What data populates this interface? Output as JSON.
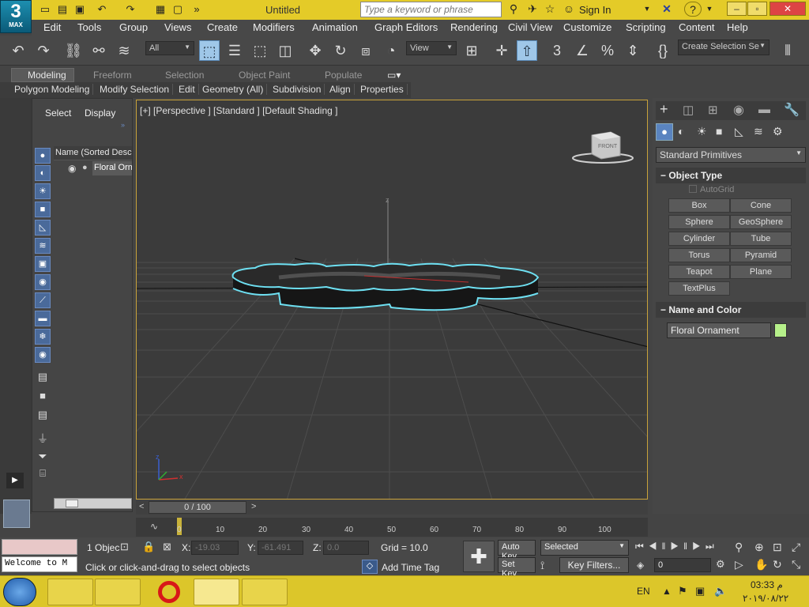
{
  "app": {
    "logo_big": "3",
    "logo_small": "MAX",
    "doc_title": "Untitled",
    "search_placeholder": "Type a keyword or phrase",
    "sign_in": "Sign In"
  },
  "menu": [
    "Edit",
    "Tools",
    "Group",
    "Views",
    "Create",
    "Modifiers",
    "Animation",
    "Graph Editors",
    "Rendering",
    "Civil View",
    "Customize",
    "Scripting",
    "Content",
    "Help"
  ],
  "toolbar": {
    "filter_value": "All",
    "refcoord_value": "View",
    "selection_set": "Create Selection Se"
  },
  "ribbon": {
    "tabs": [
      "Modeling",
      "Freeform",
      "Selection",
      "Object Paint",
      "Populate"
    ],
    "buttons": [
      "Polygon Modeling",
      "Modify Selection",
      "Edit",
      "Geometry (All)",
      "Subdivision",
      "Align",
      "Properties"
    ]
  },
  "scene": {
    "tab_select": "Select",
    "tab_display": "Display",
    "column": "Name (Sorted Desce",
    "item": "Floral Orn"
  },
  "viewport": {
    "label": "[+] [Perspective ] [Standard ] [Default Shading ]",
    "cube": "FRONT"
  },
  "cmd": {
    "category": "Standard Primitives",
    "object_type": "Object Type",
    "autogrid": "AutoGrid",
    "buttons": [
      "Box",
      "Cone",
      "Sphere",
      "GeoSphere",
      "Cylinder",
      "Tube",
      "Torus",
      "Pyramid",
      "Teapot",
      "Plane",
      "TextPlus"
    ],
    "name_color": "Name and Color",
    "object_name": "Floral Ornament",
    "color": "#b6f08a"
  },
  "timeline": {
    "frame": "0 / 100",
    "ticks": [
      "0",
      "10",
      "20",
      "30",
      "40",
      "50",
      "60",
      "70",
      "80",
      "90",
      "100"
    ]
  },
  "status": {
    "listener": "Welcome to M",
    "count": "1 Objec",
    "x_label": "X:",
    "x": "-19.03",
    "y_label": "Y:",
    "y": "-61.491",
    "z_label": "Z:",
    "z": "0.0",
    "grid": "Grid = 10.0",
    "prompt": "Click or click-and-drag to select objects",
    "add_time_tag": "Add Time Tag",
    "auto_key": "Auto Key",
    "set_key": "Set Key",
    "selected": "Selected",
    "key_filters": "Key Filters...",
    "frame_field": "0"
  },
  "taskbar": {
    "lang": "EN",
    "time": "03:33 م",
    "date": "٢٠١٩/٠٨/٢٢"
  }
}
